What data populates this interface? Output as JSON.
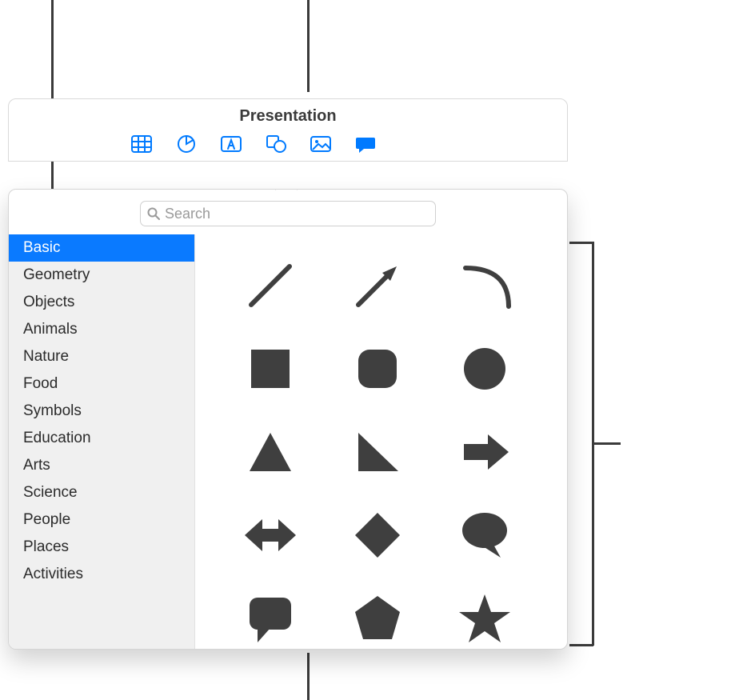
{
  "window": {
    "title": "Presentation"
  },
  "toolbar": {
    "items": [
      {
        "name": "table-icon"
      },
      {
        "name": "chart-icon"
      },
      {
        "name": "text-icon"
      },
      {
        "name": "shape-icon"
      },
      {
        "name": "media-icon"
      },
      {
        "name": "comment-icon"
      }
    ]
  },
  "search": {
    "placeholder": "Search"
  },
  "sidebar": {
    "selected_index": 0,
    "items": [
      {
        "label": "Basic"
      },
      {
        "label": "Geometry"
      },
      {
        "label": "Objects"
      },
      {
        "label": "Animals"
      },
      {
        "label": "Nature"
      },
      {
        "label": "Food"
      },
      {
        "label": "Symbols"
      },
      {
        "label": "Education"
      },
      {
        "label": "Arts"
      },
      {
        "label": "Science"
      },
      {
        "label": "People"
      },
      {
        "label": "Places"
      },
      {
        "label": "Activities"
      }
    ]
  },
  "shapes": {
    "fill": "#3f3f3f",
    "items": [
      {
        "name": "line-shape"
      },
      {
        "name": "arrow-line-shape"
      },
      {
        "name": "curve-shape"
      },
      {
        "name": "square-shape"
      },
      {
        "name": "rounded-square-shape"
      },
      {
        "name": "circle-shape"
      },
      {
        "name": "triangle-shape"
      },
      {
        "name": "right-triangle-shape"
      },
      {
        "name": "arrow-right-shape"
      },
      {
        "name": "arrow-bidirectional-shape"
      },
      {
        "name": "diamond-shape"
      },
      {
        "name": "speech-bubble-round-shape"
      },
      {
        "name": "speech-bubble-square-shape"
      },
      {
        "name": "pentagon-shape"
      },
      {
        "name": "star-shape"
      }
    ]
  },
  "colors": {
    "accent": "#007aff",
    "icon_blue": "#007aff",
    "shape_fill": "#3f3f3f"
  }
}
